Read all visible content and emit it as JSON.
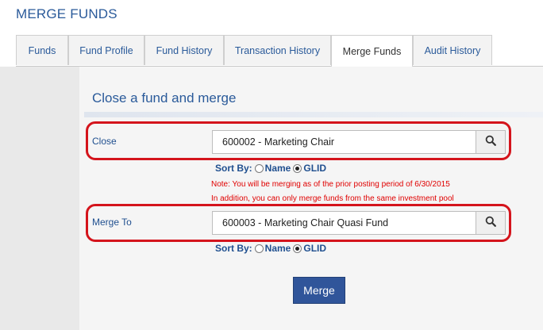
{
  "page": {
    "title": "MERGE FUNDS"
  },
  "tabs": [
    {
      "label": "Funds",
      "active": false
    },
    {
      "label": "Fund Profile",
      "active": false
    },
    {
      "label": "Fund History",
      "active": false
    },
    {
      "label": "Transaction History",
      "active": false
    },
    {
      "label": "Merge Funds",
      "active": true
    },
    {
      "label": "Audit History",
      "active": false
    }
  ],
  "section": {
    "title": "Close a fund and merge"
  },
  "close": {
    "label": "Close",
    "value": "600002 - Marketing Chair",
    "sort_label": "Sort By:",
    "sort_options": [
      "Name",
      "GLID"
    ],
    "sort_selected": "GLID"
  },
  "notes": {
    "line1": "Note: You will be merging as of the prior posting period of 6/30/2015",
    "line2": "In addition, you can only merge funds from the same investment pool"
  },
  "merge_to": {
    "label": "Merge To",
    "value": "600003 - Marketing Chair Quasi Fund",
    "sort_label": "Sort By:",
    "sort_options": [
      "Name",
      "GLID"
    ],
    "sort_selected": "GLID"
  },
  "actions": {
    "merge_label": "Merge"
  },
  "colors": {
    "accent": "#30559a",
    "title": "#2a5a9a",
    "highlight_outline": "#d4141c",
    "note_text": "#e00000"
  }
}
